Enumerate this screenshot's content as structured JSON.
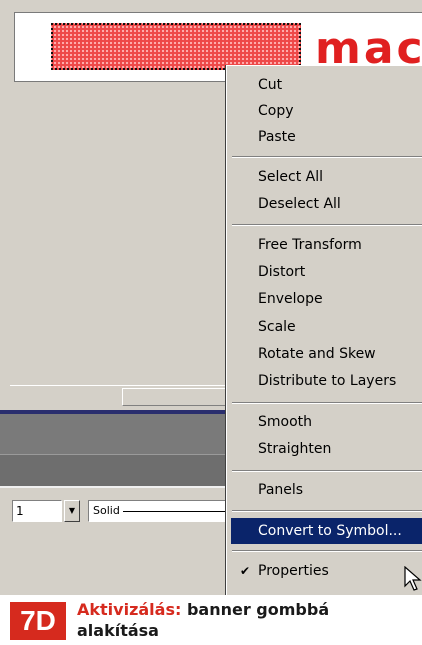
{
  "stage": {
    "banner_text": "mac",
    "banner_color": "#ee4848"
  },
  "properties_bar": {
    "stroke_width": "1",
    "stroke_style": "Solid"
  },
  "context_menu": {
    "items": [
      {
        "label": "Cut"
      },
      {
        "label": "Copy"
      },
      {
        "label": "Paste"
      },
      {
        "label": "Select All"
      },
      {
        "label": "Deselect All"
      },
      {
        "label": "Free Transform"
      },
      {
        "label": "Distort"
      },
      {
        "label": "Envelope"
      },
      {
        "label": "Scale"
      },
      {
        "label": "Rotate and Skew"
      },
      {
        "label": "Distribute to Layers"
      },
      {
        "label": "Smooth"
      },
      {
        "label": "Straighten"
      },
      {
        "label": "Panels"
      },
      {
        "label": "Convert to Symbol..."
      },
      {
        "label": "Properties"
      }
    ],
    "highlighted": "Convert to Symbol...",
    "checked": "Properties",
    "highlight_color": "#0a246a"
  },
  "caption": {
    "tag": "7D",
    "lead": "Aktivizálás:",
    "text": " banner gombbá alakítása",
    "accent_color": "#d62a1e"
  },
  "icons": {
    "dropdown": "chevron-down-icon",
    "check": "check-icon",
    "cursor": "mouse-pointer-icon"
  }
}
